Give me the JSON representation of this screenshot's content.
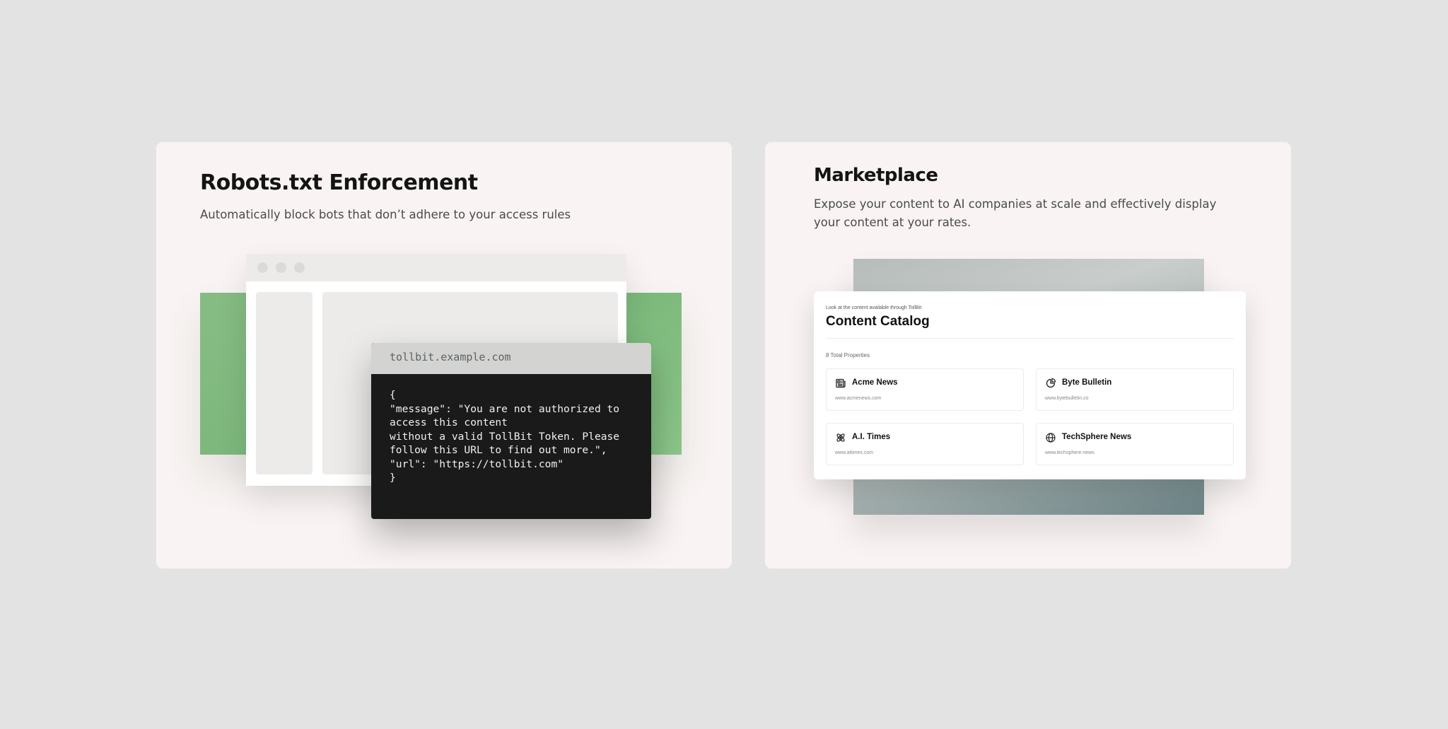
{
  "robots": {
    "title": "Robots.txt Enforcement",
    "subtitle": "Automatically block bots that don’t adhere to your access rules",
    "terminal": {
      "domain": "tollbit.example.com",
      "response": "{\n\"message\": \"You are not authorized to\naccess this content\nwithout a valid TollBit Token. Please\nfollow this URL to find out more.\",\n\"url\": \"https://tollbit.com\"\n}"
    }
  },
  "marketplace": {
    "title": "Marketplace",
    "subtitle": "Expose your content to AI companies at scale and effectively display your content at your rates.",
    "catalog": {
      "eyebrow": "Look at the content available through TollBit",
      "title": "Content Catalog",
      "count": "8 Total Properties",
      "properties": [
        {
          "name": "Acme News",
          "url": "www.acmenews.com",
          "icon": "newspaper-icon"
        },
        {
          "name": "Byte Bulletin",
          "url": "www.bytebulletin.co",
          "icon": "pie-chart-icon"
        },
        {
          "name": "A.I. Times",
          "url": "www.aitimes.com",
          "icon": "atom-icon"
        },
        {
          "name": "TechSphere News",
          "url": "www.techsphere.news",
          "icon": "globe-icon"
        }
      ]
    }
  },
  "colors": {
    "background": "#e3e3e3",
    "card": "#f9f4f3",
    "accent_green": "#7bb77a",
    "terminal": "#1a1a1a"
  }
}
